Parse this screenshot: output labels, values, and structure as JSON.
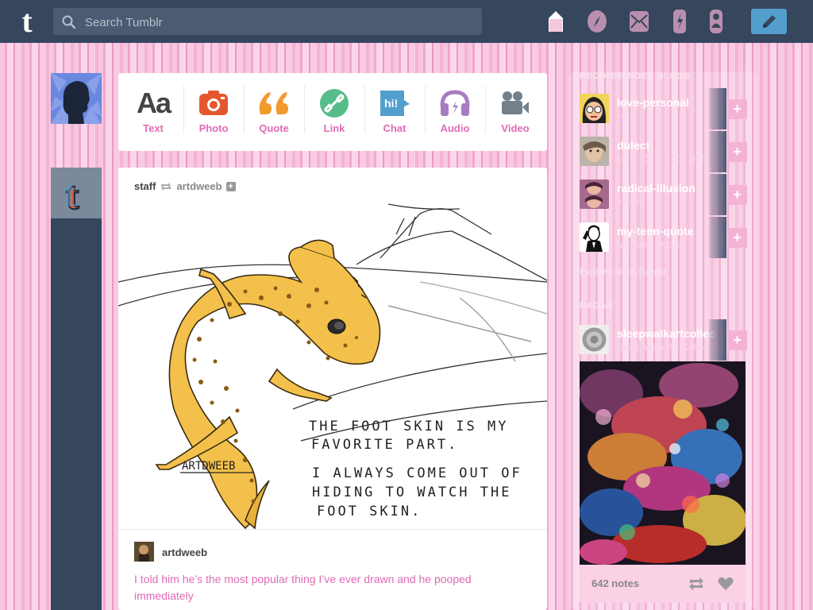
{
  "topbar": {
    "logo": "t",
    "search_placeholder": "Search Tumblr",
    "nav": [
      "home-icon",
      "explore-icon",
      "inbox-icon",
      "activity-icon",
      "account-icon"
    ],
    "compose_icon": "pencil-icon"
  },
  "post_types": [
    {
      "label": "Text",
      "icon": "text-icon",
      "color": "#444444"
    },
    {
      "label": "Photo",
      "icon": "camera-icon",
      "color": "#d95e40"
    },
    {
      "label": "Quote",
      "icon": "quote-icon",
      "color": "#f2992e"
    },
    {
      "label": "Link",
      "icon": "link-icon",
      "color": "#56bc8a"
    },
    {
      "label": "Chat",
      "icon": "chat-icon",
      "color": "#529ecc"
    },
    {
      "label": "Audio",
      "icon": "headphones-icon",
      "color": "#a77dc2"
    },
    {
      "label": "Video",
      "icon": "video-camera-icon",
      "color": "#748089"
    }
  ],
  "post": {
    "author": "staff",
    "reblogged_from": "artdweeb",
    "follow_symbol": "+",
    "comic_text": [
      "THE FOOT SKIN IS MY",
      "FAVORITE PART.",
      "I ALWAYS COME OUT OF",
      "HIDING TO WATCH THE",
      "FOOT SKIN."
    ],
    "signature": "ARTDWEEB",
    "reblog_user": "artdweeb",
    "caption": "I told him he’s the most popular thing I’ve ever drawn and he pooped immediately"
  },
  "sidebar": {
    "recommended_heading": "RECOMMENDED BLOGS",
    "blogs": [
      {
        "name": "love-personal",
        "subtitle": "Hi"
      },
      {
        "name": "dulect",
        "subtitle": "G L O R I O U S"
      },
      {
        "name": "radical-illusion",
        "subtitle": "simple"
      },
      {
        "name": "my-teen-quote",
        "subtitle": "My Teen Quote"
      }
    ],
    "explore_link": "Explore all of Tumblr",
    "radar_heading": "RADAR",
    "radar": {
      "name": "sleepwalkartcollec",
      "subtitle": "Sleep Walk Art Collec",
      "notes": "642 notes"
    },
    "follow_symbol": "+"
  }
}
